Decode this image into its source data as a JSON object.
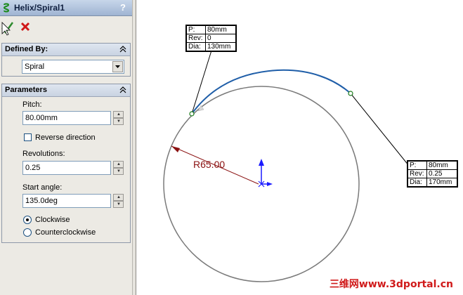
{
  "title": "Helix/Spiral1",
  "help": "?",
  "defined_by": {
    "heading": "Defined By:",
    "value": "Spiral"
  },
  "parameters": {
    "heading": "Parameters",
    "pitch_label": "Pitch:",
    "pitch_value": "80.00mm",
    "reverse_label": "Reverse direction",
    "reverse_checked": false,
    "revolutions_label": "Revolutions:",
    "revolutions_value": "0.25",
    "start_angle_label": "Start angle:",
    "start_angle_value": "135.0deg",
    "clockwise_label": "Clockwise",
    "counterclockwise_label": "Counterclockwise",
    "direction_selected": "Clockwise"
  },
  "callout_start": {
    "p_label": "P:",
    "p_value": "80mm",
    "rev_label": "Rev:",
    "rev_value": "0",
    "dia_label": "Dia:",
    "dia_value": "130mm"
  },
  "callout_end": {
    "p_label": "P:",
    "p_value": "80mm",
    "rev_label": "Rev:",
    "rev_value": "0.25",
    "dia_label": "Dia:",
    "dia_value": "170mm"
  },
  "dimension": "R65.00",
  "watermark": "三维网www.3dportal.cn",
  "colors": {
    "spiral": "#1f5ea8",
    "circle": "#7a7a7a",
    "dimension": "#8a1010",
    "axis": "#1a1aff",
    "watermark": "#d01a1a"
  }
}
